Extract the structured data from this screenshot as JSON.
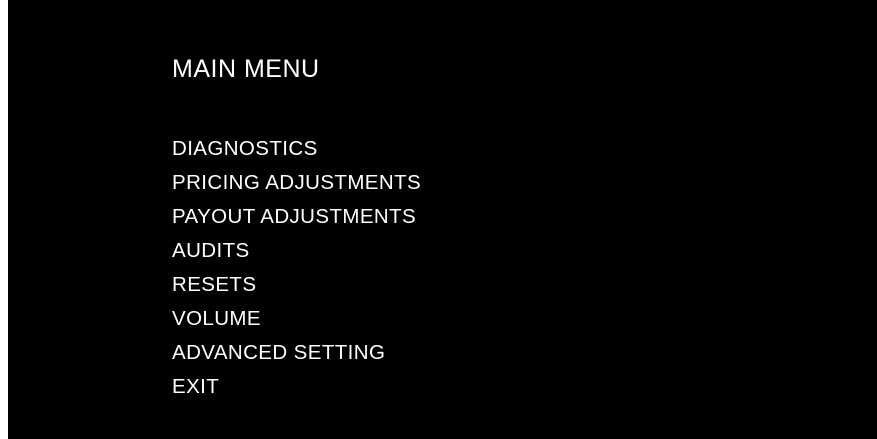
{
  "menu": {
    "title": "MAIN MENU",
    "items": [
      {
        "label": "DIAGNOSTICS"
      },
      {
        "label": "PRICING ADJUSTMENTS"
      },
      {
        "label": "PAYOUT ADJUSTMENTS"
      },
      {
        "label": "AUDITS"
      },
      {
        "label": "RESETS"
      },
      {
        "label": "VOLUME"
      },
      {
        "label": "ADVANCED SETTING"
      },
      {
        "label": "EXIT"
      }
    ]
  },
  "colors": {
    "background": "#000000",
    "text": "#ffffff"
  }
}
